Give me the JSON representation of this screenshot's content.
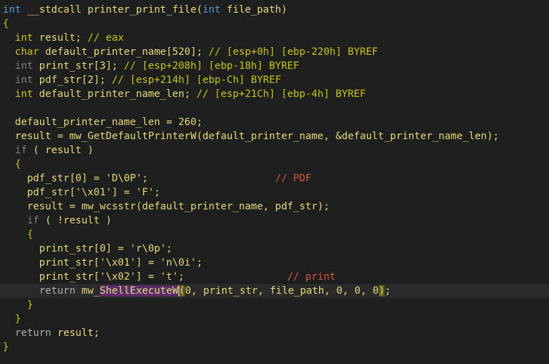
{
  "code": {
    "l1": {
      "a": "int",
      "b": " __stdcall printer_print_file(",
      "c": "int",
      "d": " file_path)"
    },
    "l2": "{",
    "l3": {
      "a": "int",
      "b": " result; ",
      "c": "// eax"
    },
    "l4": {
      "a": "char",
      "b": " default_printer_name[520]; ",
      "c": "// [esp+0h] [ebp-220h] BYREF"
    },
    "l5": {
      "a": "int",
      "b": " print_str[3]; ",
      "c": "// [esp+208h] [ebp-18h] BYREF"
    },
    "l6": {
      "a": "int",
      "b": " pdf_str[2]; ",
      "c": "// [esp+214h] [ebp-Ch] BYREF"
    },
    "l7": {
      "a": "int",
      "b": " default_printer_name_len; ",
      "c": "// [esp+21Ch] [ebp-4h] BYREF"
    },
    "l8": {
      "a": "default_printer_name_len = 260;"
    },
    "l9": {
      "a": "result = mw_GetDefaultPrinterW(default_printer_name, &default_printer_name_len);"
    },
    "l10": {
      "a": "if",
      "b": " ( result )"
    },
    "l11": "{",
    "l12": {
      "a": "pdf_str[0] = 'D\\0P';",
      "c": "// PDF"
    },
    "l13": {
      "a": "pdf_str['\\x01'] = 'F';"
    },
    "l14": {
      "a": "result = mw_wcsstr(default_printer_name, pdf_str);"
    },
    "l15": {
      "a": "if",
      "b": " ( !result )"
    },
    "l16": "{",
    "l17": {
      "a": "print_str[0] = 'r\\0p';"
    },
    "l18": {
      "a": "print_str['\\x01'] = 'n\\0i';"
    },
    "l19": {
      "a": "print_str['\\x02'] = 't';",
      "c": "// print"
    },
    "l20": {
      "a": "return",
      "b": " mw_",
      "sel": "ShellExecuteW",
      "p1": "(",
      "c": "0, print_str, file_path, 0, 0, 0",
      "p2": ")",
      "d": ";"
    },
    "l21": "}",
    "l22": "}",
    "l23": {
      "a": "return",
      "b": " result;"
    },
    "l24": "}"
  }
}
